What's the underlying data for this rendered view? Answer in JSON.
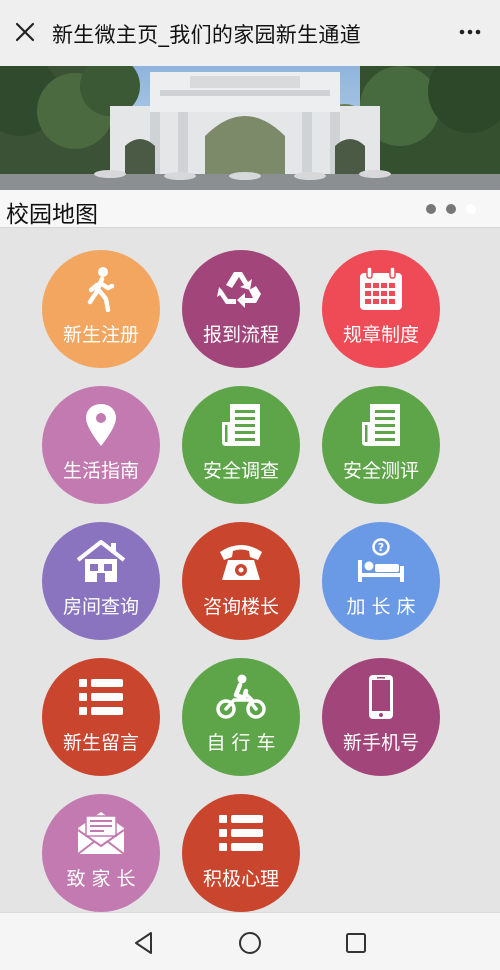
{
  "topbar": {
    "title": "新生微主页_我们的家园新生通道"
  },
  "section": {
    "heading": "校园地图"
  },
  "carousel": {
    "slides": 3,
    "active": 3
  },
  "tiles": [
    {
      "label": "新生注册",
      "icon": "walking-person-icon",
      "color": "#f2a65f"
    },
    {
      "label": "报到流程",
      "icon": "recycle-icon",
      "color": "#a2457a"
    },
    {
      "label": "规章制度",
      "icon": "calendar-icon",
      "color": "#ee4b57"
    },
    {
      "label": "生活指南",
      "icon": "location-pin-icon",
      "color": "#c37ab0"
    },
    {
      "label": "安全调查",
      "icon": "newspaper-icon",
      "color": "#5ea54a"
    },
    {
      "label": "安全测评",
      "icon": "newspaper-icon",
      "color": "#5ea54a"
    },
    {
      "label": "房间查询",
      "icon": "house-icon",
      "color": "#8a74bf"
    },
    {
      "label": "咨询楼长",
      "icon": "telephone-icon",
      "color": "#c9452e"
    },
    {
      "label": "加 长 床",
      "icon": "bed-icon",
      "color": "#6a9ae6"
    },
    {
      "label": "新生留言",
      "icon": "list-icon",
      "color": "#c9452e"
    },
    {
      "label": "自 行 车",
      "icon": "motorcycle-icon",
      "color": "#5ea54a"
    },
    {
      "label": "新手机号",
      "icon": "mobile-phone-icon",
      "color": "#a2457a"
    },
    {
      "label": "致 家 长",
      "icon": "envelope-icon",
      "color": "#c37ab0"
    },
    {
      "label": "积极心理",
      "icon": "list-icon",
      "color": "#c9452e"
    }
  ]
}
